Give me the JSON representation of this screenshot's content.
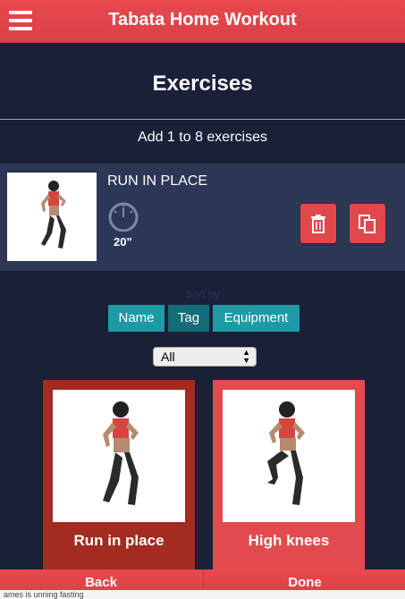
{
  "header": {
    "app_title": "Tabata Home Workout",
    "menu_icon": "hamburger-icon"
  },
  "page": {
    "heading": "Exercises",
    "instruction": "Add 1 to 8 exercises"
  },
  "selected": {
    "name": "RUN IN PLACE",
    "duration": "20\"",
    "timer_icon": "timer-icon",
    "delete_icon": "trash-icon",
    "copy_icon": "copy-icon"
  },
  "sort": {
    "label": "Sort by",
    "buttons": [
      "Name",
      "Tag",
      "Equipment"
    ],
    "active": "Tag"
  },
  "filter": {
    "selected": "All"
  },
  "exercises": [
    {
      "label": "Run in place"
    },
    {
      "label": "High knees"
    }
  ],
  "footer": {
    "back": "Back",
    "done": "Done",
    "underlay_text": "ames   is unning   fasting"
  },
  "colors": {
    "accent": "#e0484c",
    "background": "#1a2038",
    "teal": "#1e9aa6"
  }
}
